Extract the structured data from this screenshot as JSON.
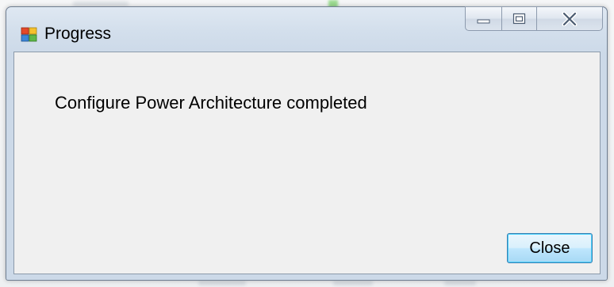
{
  "window": {
    "title": "Progress",
    "icon": "application-window-icon",
    "caption_buttons": {
      "minimize_icon": "minimize-icon",
      "maximize_icon": "maximize-icon",
      "close_icon": "close-icon"
    }
  },
  "dialog": {
    "message": "Configure Power Architecture completed",
    "close_button_label": "Close"
  },
  "colors": {
    "client_background": "#f0f0f0",
    "title_bar": "#d3dfec",
    "button_focus_border": "#3c7fb1"
  }
}
